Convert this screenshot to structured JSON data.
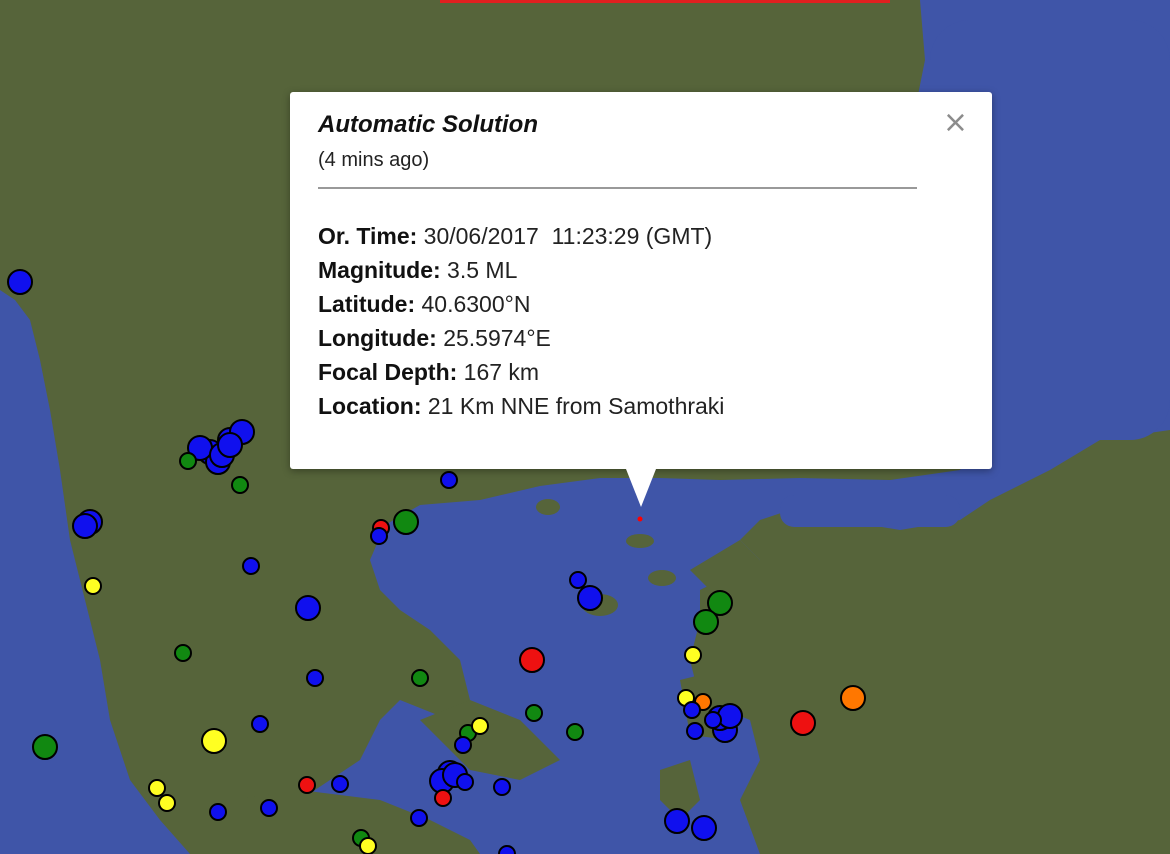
{
  "popup": {
    "title": "Automatic Solution",
    "time_ago": "(4 mins ago)",
    "close_icon": "close-icon",
    "fields": [
      {
        "label": "Or. Time:",
        "value": "30/06/2017  11:23:29 (GMT)"
      },
      {
        "label": "Magnitude:",
        "value": "3.5 ML"
      },
      {
        "label": "Latitude:",
        "value": "40.6300°N"
      },
      {
        "label": "Longitude:",
        "value": "25.5974°E"
      },
      {
        "label": "Focal Depth:",
        "value": "167 km"
      },
      {
        "label": "Location:",
        "value": "21 Km NNE from Samothraki"
      }
    ]
  },
  "colors": {
    "sea": "#3f55a8",
    "land": "#56643a",
    "marker_blue": "#1010ee",
    "marker_green": "#118811",
    "marker_yellow": "#ffff22",
    "marker_red": "#ee1111",
    "marker_orange": "#ff7700",
    "epicenter": "#ff0000"
  },
  "markers": [
    {
      "c": "blue",
      "s": "l"
    },
    {
      "c": "blue",
      "s": "l"
    },
    {
      "c": "blue",
      "s": "l"
    },
    {
      "c": "blue",
      "s": "l"
    },
    {
      "c": "blue",
      "s": "l"
    },
    {
      "c": "blue",
      "s": "l"
    },
    {
      "c": "green",
      "s": "s"
    },
    {
      "c": "green",
      "s": "s"
    },
    {
      "c": "blue",
      "s": "l"
    },
    {
      "c": "blue",
      "s": "l"
    },
    {
      "c": "yellow",
      "s": "s"
    },
    {
      "c": "blue",
      "s": "s"
    },
    {
      "c": "red",
      "s": "s"
    },
    {
      "c": "blue",
      "s": "s"
    },
    {
      "c": "green",
      "s": "l"
    },
    {
      "c": "blue",
      "s": "s"
    },
    {
      "c": "blue",
      "s": "l"
    },
    {
      "c": "green",
      "s": "s"
    },
    {
      "c": "blue",
      "s": "s"
    },
    {
      "c": "green",
      "s": "s"
    },
    {
      "c": "blue",
      "s": "s"
    },
    {
      "c": "green",
      "s": "l"
    },
    {
      "c": "yellow",
      "s": "l"
    },
    {
      "c": "yellow",
      "s": "s"
    },
    {
      "c": "yellow",
      "s": "s"
    },
    {
      "c": "blue",
      "s": "s"
    },
    {
      "c": "blue",
      "s": "s"
    },
    {
      "c": "red",
      "s": "s"
    },
    {
      "c": "blue",
      "s": "s"
    },
    {
      "c": "green",
      "s": "s"
    },
    {
      "c": "yellow",
      "s": "s"
    },
    {
      "c": "red",
      "s": "l"
    },
    {
      "c": "blue",
      "s": "s"
    },
    {
      "c": "blue",
      "s": "l"
    },
    {
      "c": "green",
      "s": "s"
    },
    {
      "c": "green",
      "s": "s"
    },
    {
      "c": "blue",
      "s": "s"
    },
    {
      "c": "yellow",
      "s": "s"
    },
    {
      "c": "green",
      "s": "s"
    },
    {
      "c": "blue",
      "s": "s"
    },
    {
      "c": "blue",
      "s": "l"
    },
    {
      "c": "blue",
      "s": "l"
    },
    {
      "c": "blue",
      "s": "s"
    },
    {
      "c": "red",
      "s": "s"
    },
    {
      "c": "blue",
      "s": "s"
    },
    {
      "c": "blue",
      "s": "s"
    },
    {
      "c": "blue",
      "s": "l"
    },
    {
      "c": "green",
      "s": "l"
    },
    {
      "c": "green",
      "s": "l"
    },
    {
      "c": "yellow",
      "s": "s"
    },
    {
      "c": "yellow",
      "s": "s"
    },
    {
      "c": "orange",
      "s": "s"
    },
    {
      "c": "blue",
      "s": "s"
    },
    {
      "c": "blue",
      "s": "l"
    },
    {
      "c": "blue",
      "s": "l"
    },
    {
      "c": "blue",
      "s": "s"
    },
    {
      "c": "red",
      "s": "l"
    },
    {
      "c": "orange",
      "s": "l"
    },
    {
      "c": "blue",
      "s": "l"
    },
    {
      "c": "blue",
      "s": "l"
    },
    {
      "c": "blue",
      "s": "l"
    },
    {
      "c": "blue",
      "s": "s"
    },
    {
      "c": "blue",
      "s": "l"
    },
    {
      "c": "blue",
      "s": "l"
    }
  ]
}
